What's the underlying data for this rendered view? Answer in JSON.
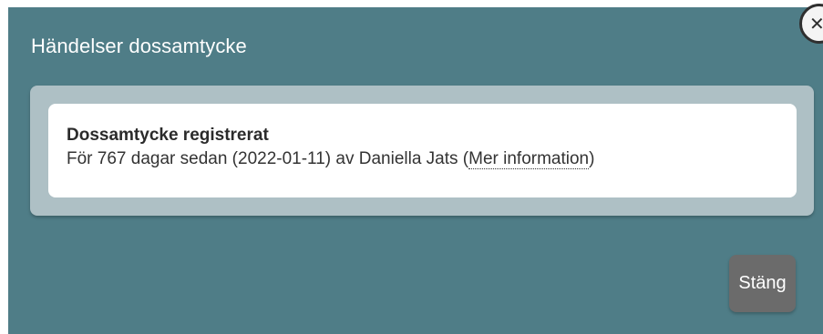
{
  "dialog": {
    "title": "Händelser dossamtycke",
    "close_icon_glyph": "✕"
  },
  "events": [
    {
      "title": "Dossamtycke registrerat",
      "detail_prefix": "För 767 dagar sedan (2022-01-11) av Daniella Jats (",
      "link_label": "Mer information",
      "detail_suffix": ")"
    }
  ],
  "footer": {
    "close_label": "Stäng"
  },
  "colors": {
    "dialog_background": "#4f7d87",
    "panel_background": "#aec0c5",
    "card_background": "#ffffff",
    "close_button_background": "#6b6b6b"
  }
}
